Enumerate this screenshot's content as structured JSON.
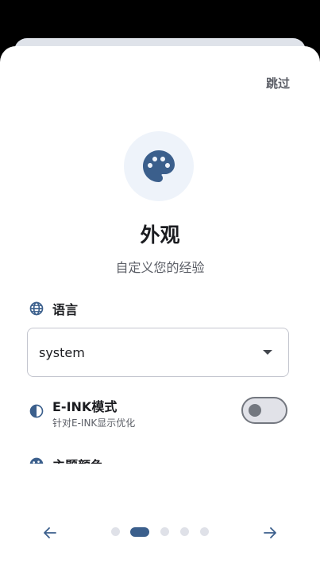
{
  "header": {
    "skip_label": "跳过"
  },
  "hero": {
    "icon": "palette-icon",
    "title": "外观",
    "subtitle": "自定义您的经验"
  },
  "language": {
    "icon": "globe-icon",
    "label": "语言",
    "selected": "system"
  },
  "eink": {
    "icon": "contrast-icon",
    "label": "E-INK模式",
    "description": "针对E-INK显示优化",
    "enabled": false
  },
  "theme_color": {
    "icon": "palette-icon",
    "label": "主题颜色"
  },
  "pager": {
    "prev_icon": "arrow-left-icon",
    "next_icon": "arrow-right-icon",
    "total_pages": 5,
    "current_page": 2
  },
  "colors": {
    "accent": "#3b5f8c",
    "hero_bg": "#eef3fa",
    "dot_inactive": "#dfe1e8"
  }
}
